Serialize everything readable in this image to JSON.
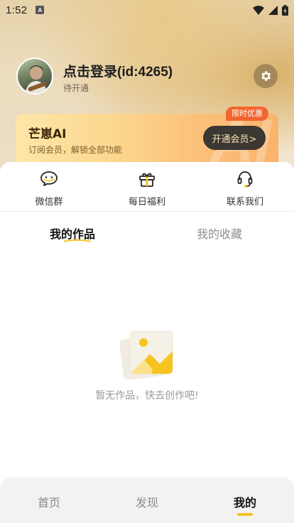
{
  "status_bar": {
    "time": "1:52",
    "notification_badge": "A",
    "icons": [
      "wifi-icon",
      "cell-signal-icon",
      "battery-icon"
    ]
  },
  "profile": {
    "name": "点击登录(id:4265)",
    "subtitle": "待开通"
  },
  "vip_card": {
    "title": "芒崽AI",
    "description": "订阅会员，解锁全部功能",
    "button_label": "开通会员>",
    "badge": "限时优惠"
  },
  "quick_actions": [
    {
      "label": "微信群",
      "icon": "wechat-group-icon"
    },
    {
      "label": "每日福利",
      "icon": "gift-icon"
    },
    {
      "label": "联系我们",
      "icon": "headset-icon"
    }
  ],
  "tabs": {
    "works": "我的作品",
    "favorites": "我的收藏"
  },
  "empty_state": {
    "message": "暂无作品，快去创作吧!"
  },
  "bottom_nav": {
    "home": "首页",
    "discover": "发现",
    "mine": "我的"
  },
  "colors": {
    "accent": "#f5c421",
    "promo": "#f2652f",
    "vip_button": "#3b3732"
  }
}
